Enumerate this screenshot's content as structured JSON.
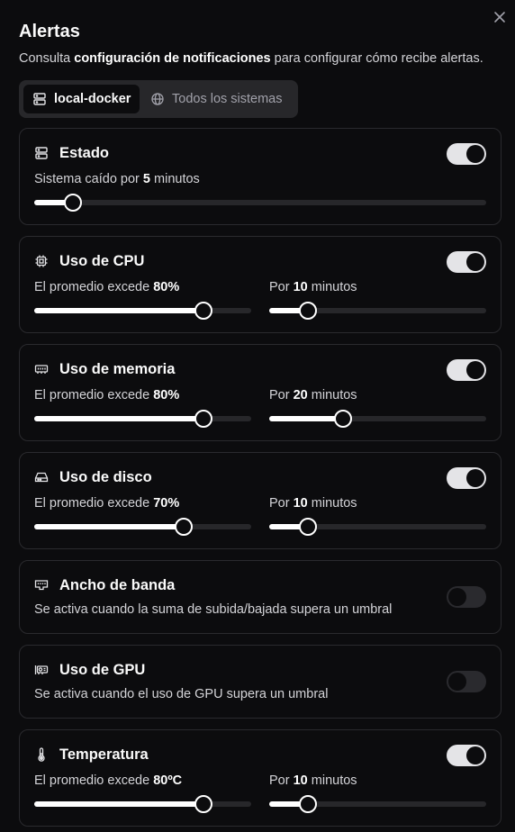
{
  "dialog": {
    "title": "Alertas",
    "desc_prefix": "Consulta ",
    "desc_link": "configuración de notificaciones",
    "desc_suffix": " para configurar cómo recibe alertas.",
    "close_icon": "x-icon"
  },
  "tabs": [
    {
      "label": "local-docker",
      "icon": "server-icon",
      "active": true
    },
    {
      "label": "Todos los sistemas",
      "icon": "globe-icon",
      "active": false
    }
  ],
  "colors": {
    "background": "#0c0c0e",
    "card_border": "#2a2a2e",
    "accent": "#ffffff",
    "track": "#27272a"
  },
  "alerts": [
    {
      "title": "Estado",
      "icon": "server-icon",
      "enabled": true,
      "line_prefix": "Sistema caído por ",
      "line_value": "5",
      "line_suffix": " minutos",
      "slider_fraction": 0.085
    },
    {
      "title": "Uso de CPU",
      "icon": "cpu-icon",
      "enabled": true,
      "avg_prefix": "El promedio excede ",
      "avg_value": "80%",
      "dur_prefix": "Por ",
      "dur_value": "10",
      "dur_suffix": " minutos",
      "avg_fraction": 0.78,
      "dur_fraction": 0.18
    },
    {
      "title": "Uso de memoria",
      "icon": "memory-icon",
      "enabled": true,
      "avg_prefix": "El promedio excede ",
      "avg_value": "80%",
      "dur_prefix": "Por ",
      "dur_value": "20",
      "dur_suffix": " minutos",
      "avg_fraction": 0.78,
      "dur_fraction": 0.34
    },
    {
      "title": "Uso de disco",
      "icon": "disk-icon",
      "enabled": true,
      "avg_prefix": "El promedio excede ",
      "avg_value": "70%",
      "dur_prefix": "Por ",
      "dur_value": "10",
      "dur_suffix": " minutos",
      "avg_fraction": 0.69,
      "dur_fraction": 0.18
    },
    {
      "title": "Ancho de banda",
      "icon": "network-icon",
      "enabled": false,
      "description": "Se activa cuando la suma de subida/bajada supera un umbral"
    },
    {
      "title": "Uso de GPU",
      "icon": "gpu-icon",
      "enabled": false,
      "description": "Se activa cuando el uso de GPU supera un umbral"
    },
    {
      "title": "Temperatura",
      "icon": "thermometer-icon",
      "enabled": true,
      "avg_prefix": "El promedio excede ",
      "avg_value": "80ºC",
      "dur_prefix": "Por ",
      "dur_value": "10",
      "dur_suffix": " minutos",
      "avg_fraction": 0.78,
      "dur_fraction": 0.18
    }
  ]
}
